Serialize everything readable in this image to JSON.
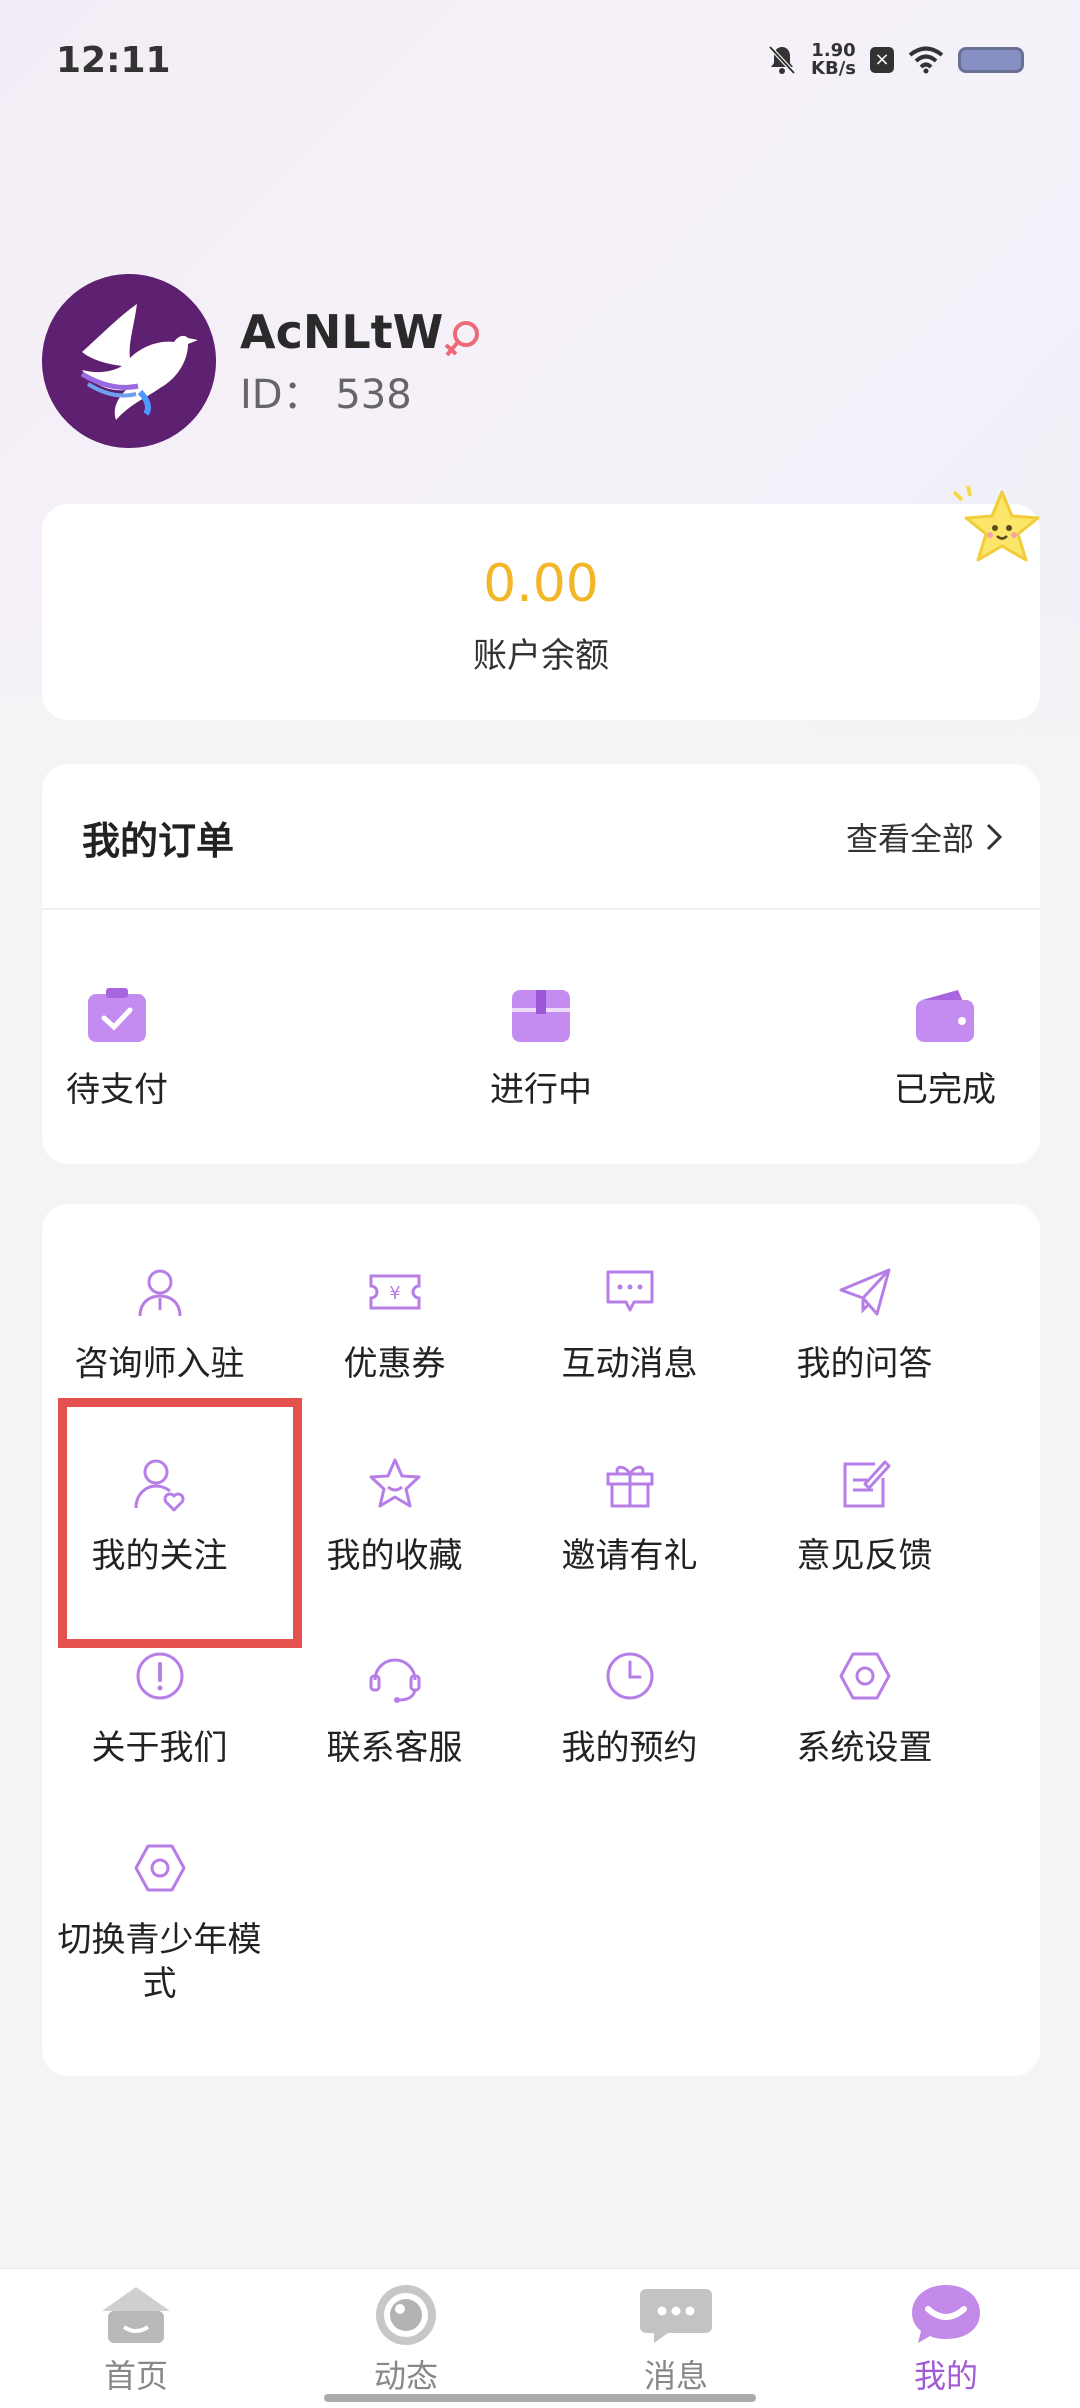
{
  "status_bar": {
    "time": "12:11",
    "net_speed": "1.90",
    "net_unit": "KB/s"
  },
  "profile": {
    "username": "AcNLtW",
    "id_label": "ID：",
    "id_value": "538"
  },
  "balance": {
    "amount": "0.00",
    "label": "账户余额"
  },
  "orders": {
    "title": "我的订单",
    "view_all": "查看全部",
    "items": [
      {
        "label": "待支付",
        "icon": "pending-payment-icon"
      },
      {
        "label": "进行中",
        "icon": "in-progress-icon"
      },
      {
        "label": "已完成",
        "icon": "completed-wallet-icon"
      }
    ]
  },
  "services": {
    "items": [
      {
        "label": "咨询师入驻",
        "icon": "person-icon"
      },
      {
        "label": "优惠券",
        "icon": "coupon-icon"
      },
      {
        "label": "互动消息",
        "icon": "message-icon"
      },
      {
        "label": "我的问答",
        "icon": "paper-plane-icon"
      },
      {
        "label": "我的关注",
        "icon": "person-heart-icon"
      },
      {
        "label": "我的收藏",
        "icon": "star-icon"
      },
      {
        "label": "邀请有礼",
        "icon": "gift-icon"
      },
      {
        "label": "意见反馈",
        "icon": "edit-icon"
      },
      {
        "label": "关于我们",
        "icon": "info-icon"
      },
      {
        "label": "联系客服",
        "icon": "headset-icon"
      },
      {
        "label": "我的预约",
        "icon": "clock-icon"
      },
      {
        "label": "系统设置",
        "icon": "settings-hex-icon"
      },
      {
        "label": "切换青少年模式",
        "icon": "youth-mode-hex-icon"
      }
    ]
  },
  "bottom_nav": {
    "items": [
      {
        "label": "首页",
        "icon": "home-icon"
      },
      {
        "label": "动态",
        "icon": "eye-icon"
      },
      {
        "label": "消息",
        "icon": "chat-bubble-icon"
      },
      {
        "label": "我的",
        "icon": "smile-bubble-icon"
      }
    ],
    "active": "我的"
  },
  "colors": {
    "accent": "#a35ad6",
    "balance": "#f1b728",
    "highlight": "#e5514f"
  }
}
